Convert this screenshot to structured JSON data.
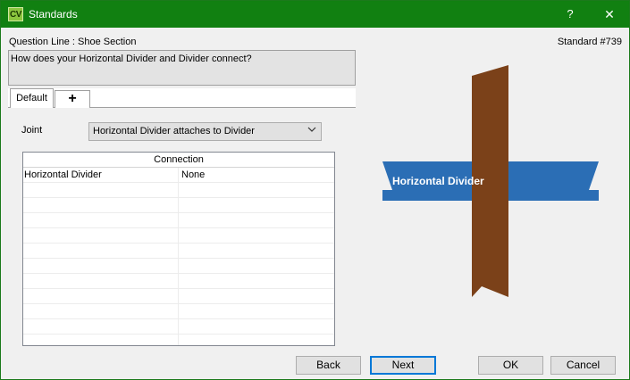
{
  "window": {
    "icon_text": "CV",
    "title": "Standards",
    "help_label": "?",
    "close_label": "✕"
  },
  "header": {
    "question_line": "Question Line : Shoe Section",
    "standard_number": "Standard #739",
    "question_text": "How does your Horizontal Divider and Divider connect?"
  },
  "tabs": {
    "default_label": "Default",
    "add_label": "+"
  },
  "joint": {
    "label": "Joint",
    "selected": "Horizontal Divider attaches to Divider"
  },
  "grid": {
    "header": "Connection",
    "rows": [
      {
        "part": "Horizontal Divider",
        "value": "None"
      }
    ]
  },
  "diagram": {
    "label": "Horizontal Divider",
    "colors": {
      "horizontal": "#2b6eb5",
      "vertical": "#7b4119"
    }
  },
  "buttons": {
    "back": "Back",
    "next": "Next",
    "ok": "OK",
    "cancel": "Cancel"
  }
}
